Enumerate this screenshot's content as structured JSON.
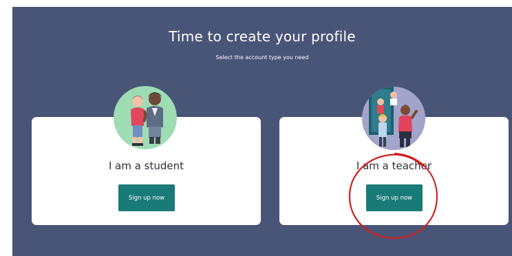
{
  "header": {
    "title": "Time to create your profile",
    "subtitle": "Select the account type you need"
  },
  "cards": [
    {
      "label": "I am a student",
      "button_label": "Sign up now",
      "illustration": "student-illustration"
    },
    {
      "label": "I am a teacher",
      "button_label": "Sign up now",
      "illustration": "teacher-illustration"
    }
  ],
  "colors": {
    "background_panel": "#495577",
    "card": "#ffffff",
    "button": "#1a7a78",
    "annotation_circle": "#d0201f"
  }
}
